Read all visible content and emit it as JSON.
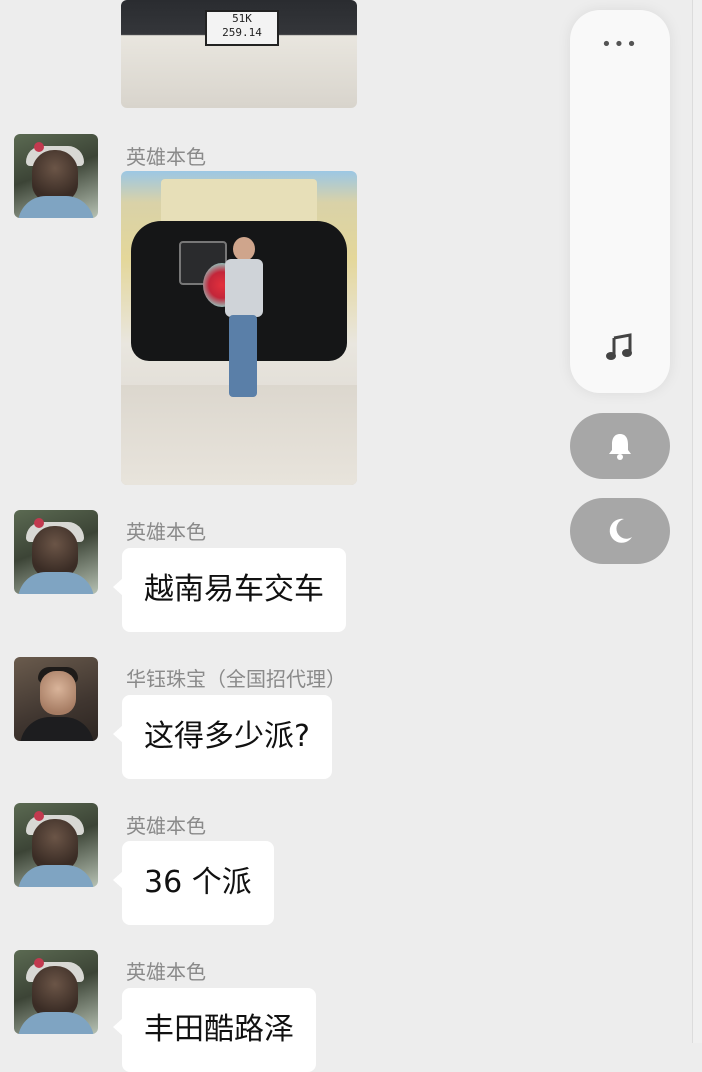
{
  "messages": [
    {
      "type": "image",
      "plate_line1": "51K",
      "plate_line2": "259.14"
    },
    {
      "type": "image",
      "sender": "英雄本色"
    },
    {
      "type": "text",
      "sender": "英雄本色",
      "text": "越南易车交车"
    },
    {
      "type": "text",
      "sender": "华钰珠宝（全国招代理）",
      "text": "这得多少派?"
    },
    {
      "type": "text",
      "sender": "英雄本色",
      "text": "36 个派"
    },
    {
      "type": "text",
      "sender": "英雄本色",
      "text": "丰田酷路泽"
    }
  ],
  "floating_panel": {
    "more_icon": "ellipsis-icon",
    "music_icon": "music-note-icon",
    "bell_icon": "bell-icon",
    "moon_icon": "moon-icon"
  },
  "colors": {
    "background": "#ededed",
    "bubble": "#ffffff",
    "sender_name": "#8a8a8a",
    "round_button": "#a7a7a7"
  }
}
